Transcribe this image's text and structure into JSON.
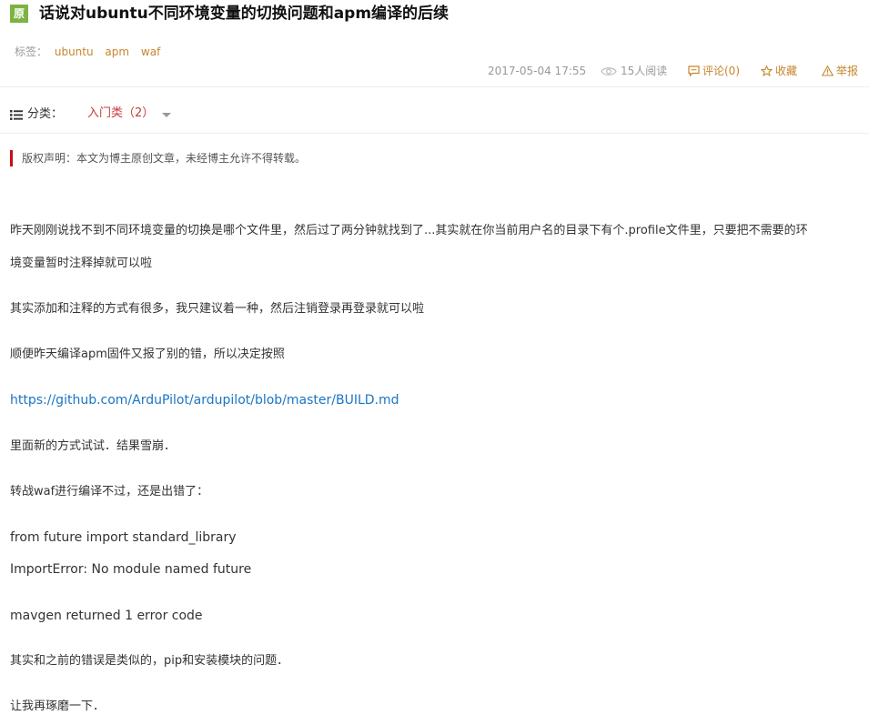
{
  "header": {
    "badge": "原",
    "title": "话说对ubuntu不同环境变量的切换问题和apm编译的后续",
    "tags_label": "标签：",
    "tags": [
      "ubuntu",
      "apm",
      "waf"
    ],
    "date": "2017-05-04 17:55",
    "views": "15人阅读",
    "comment": "评论(0)",
    "favorite": "收藏",
    "report": "举报"
  },
  "category": {
    "label": "分类：",
    "value": "入门类（2）"
  },
  "copyright": "版权声明：本文为博主原创文章，未经博主允许不得转载。",
  "article": {
    "p1_line1": "昨天刚刚说找不到不同环境变量的切换是哪个文件里，然后过了两分钟就找到了...其实就在你当前用户名的目录下有个.profile文件里，只要把不需要的环",
    "p1_line2": "境变量暂时注释掉就可以啦",
    "p2": "其实添加和注释的方式有很多，我只建议着一种，然后注销登录再登录就可以啦",
    "p3": "顺便昨天编译apm固件又报了别的错，所以决定按照",
    "link": "https://github.com/ArduPilot/ardupilot/blob/master/BUILD.md",
    "p4": "里面新的方式试试．结果雪崩．",
    "p5": "转战waf进行编译不过，还是出错了：",
    "err1": "from future import standard_library",
    "err2": "ImportError: No module named future",
    "err3": "mavgen returned 1 error code",
    "p6": "其实和之前的错误是类似的，pip和安装模块的问题．",
    "p7": "让我再琢磨一下．"
  },
  "colors": {
    "accent": "#c7852c",
    "category": "#ca3a3a",
    "link": "#1b75c4",
    "badge": "#7cb342",
    "copyright_bar": "#ca0c16"
  },
  "icons": [
    "eye-icon",
    "comment-icon",
    "star-icon",
    "warning-icon",
    "list-icon",
    "chevron-down-icon"
  ]
}
